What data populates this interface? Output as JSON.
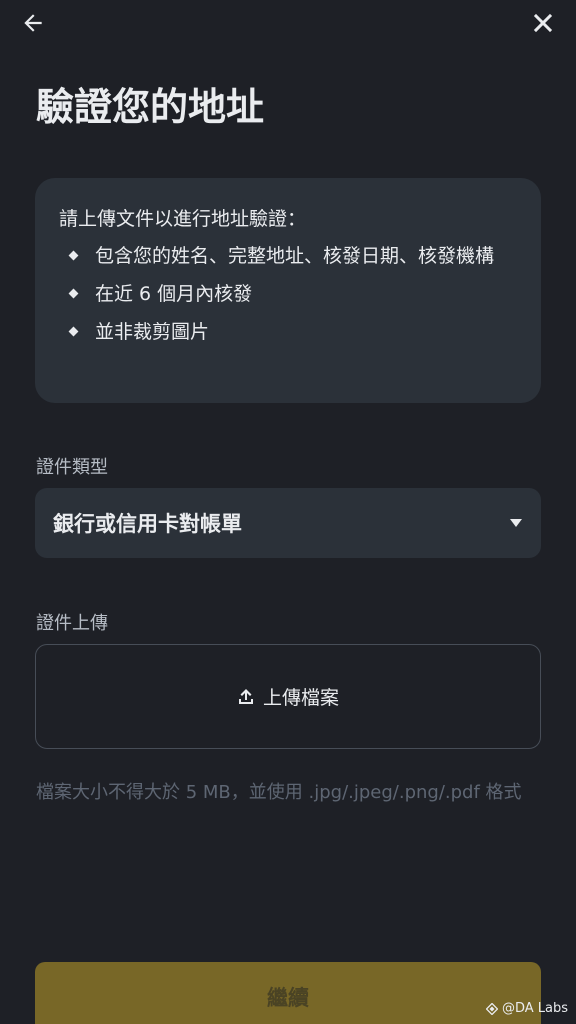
{
  "header": {
    "back_icon": "arrow-left-icon",
    "close_icon": "close-icon"
  },
  "page": {
    "title": "驗證您的地址"
  },
  "info_card": {
    "heading": "請上傳文件以進行地址驗證：",
    "items": [
      {
        "text": "包含您的姓名、完整地址、核發日期、核發機構"
      },
      {
        "text": "在近 6 個月內核發"
      },
      {
        "text": "並非裁剪圖片"
      }
    ]
  },
  "document_type": {
    "label": "證件類型",
    "selected_value": "銀行或信用卡對帳單",
    "icon": "caret-down-icon"
  },
  "document_upload": {
    "label": "證件上傳",
    "button_label": "上傳檔案",
    "icon": "upload-icon",
    "hint": "檔案大小不得大於 5 MB，並使用 .jpg/.jpeg/.png/.pdf 格式"
  },
  "footer": {
    "continue_label": "繼續"
  },
  "watermark": {
    "text": "@DA Labs"
  },
  "colors": {
    "background": "#1e2026",
    "card": "#2b3139",
    "primary_text": "#eaecef",
    "secondary_text": "#b7bdc6",
    "muted_text": "#5e6673",
    "button_disabled": "#786727"
  }
}
